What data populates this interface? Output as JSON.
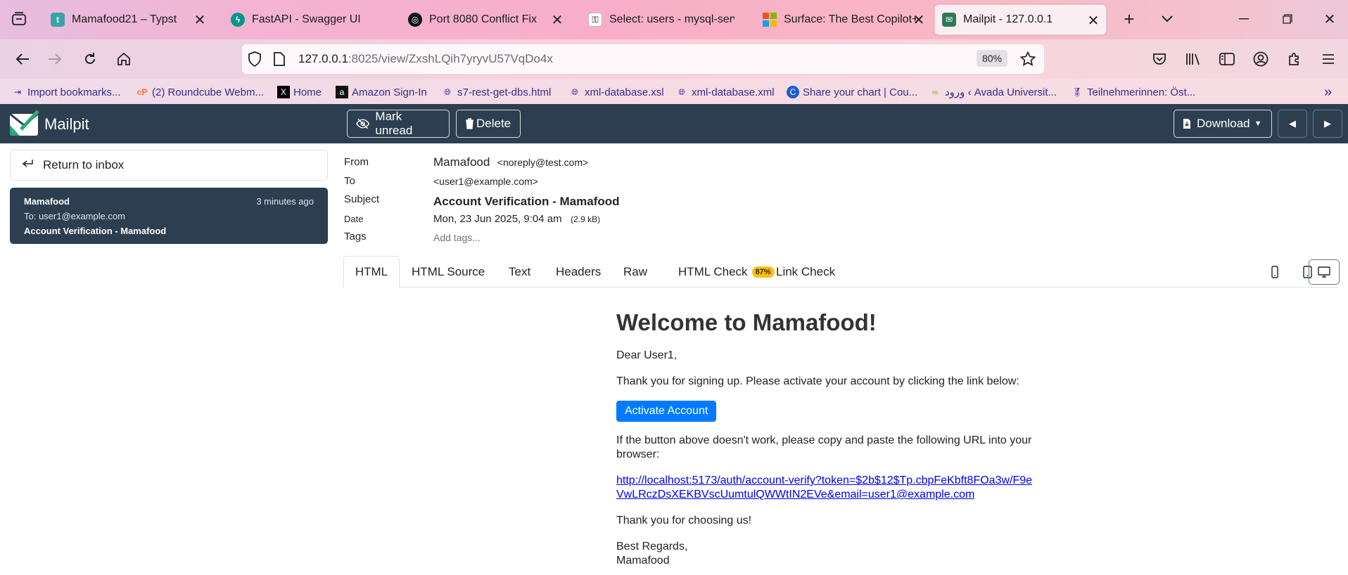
{
  "browser": {
    "tabs": [
      {
        "title": "Mamafood21 – Typst",
        "favicon_color": "#3aa3a7",
        "favicon_glyph": "t"
      },
      {
        "title": "FastAPI - Swagger UI",
        "favicon_color": "#049688",
        "favicon_glyph": "ϟ"
      },
      {
        "title": "Port 8080 Conflict Fix",
        "favicon_color": "#111111",
        "favicon_glyph": "◎"
      },
      {
        "title": "Select: users - mysql-servic",
        "favicon_color": "#b0b0b0",
        "favicon_glyph": "⚿"
      },
      {
        "title": "Surface: The Best Copilot+",
        "favicon_color": "#f25022",
        "favicon_glyph": ""
      },
      {
        "title": "Mailpit - 127.0.0.1",
        "favicon_color": "#2c7a5b",
        "favicon_glyph": "✉"
      }
    ],
    "url_host": "127.0.0.1",
    "url_rest": ":8025/view/ZxshLQih7yryvU57VqDo4x",
    "zoom": "80%",
    "bookmarks": [
      {
        "label": "Import bookmarks...",
        "icon": "import-icon"
      },
      {
        "label": "(2) Roundcube Webm...",
        "icon": "cpanel-icon"
      },
      {
        "label": "Home",
        "icon": "x-icon"
      },
      {
        "label": "Amazon Sign-In",
        "icon": "amazon-icon"
      },
      {
        "label": "s7-rest-get-dbs.html",
        "icon": "globe-icon"
      },
      {
        "label": "xml-database.xsl",
        "icon": "globe-icon"
      },
      {
        "label": "xml-database.xml",
        "icon": "globe-icon"
      },
      {
        "label": "Share your chart | Cou...",
        "icon": "c-icon"
      },
      {
        "label": "ورود ‹ Avada Universit...",
        "icon": "infinity-icon"
      },
      {
        "label": "Teilnehmerinnen: Öst...",
        "icon": "medal-icon"
      }
    ]
  },
  "mailpit": {
    "brand": "Mailpit",
    "toolbar": {
      "mark_unread": "Mark unread",
      "delete": "Delete",
      "download": "Download"
    },
    "sidebar": {
      "return_label": "Return to inbox",
      "message": {
        "from": "Mamafood",
        "time": "3 minutes ago",
        "to": "To: user1@example.com",
        "subject": "Account Verification - Mamafood"
      }
    },
    "headers": {
      "from_label": "From",
      "from_name": "Mamafood",
      "from_email": "<noreply@test.com>",
      "to_label": "To",
      "to_value": "<user1@example.com>",
      "subject_label": "Subject",
      "subject_value": "Account Verification - Mamafood",
      "date_label": "Date",
      "date_value": "Mon, 23 Jun 2025, 9:04 am",
      "size_value": "(2.9 kB)",
      "tags_label": "Tags",
      "tags_placeholder": "Add tags..."
    },
    "tabs": [
      {
        "label": "HTML"
      },
      {
        "label": "HTML Source"
      },
      {
        "label": "Text"
      },
      {
        "label": "Headers"
      },
      {
        "label": "Raw"
      },
      {
        "label": "HTML Check",
        "badge": "87%"
      },
      {
        "label": "Link Check"
      }
    ]
  },
  "email": {
    "heading": "Welcome to Mamafood!",
    "greeting": "Dear User1,",
    "intro": "Thank you for signing up. Please activate your account by clicking the link below:",
    "button": "Activate Account",
    "fallback": "If the button above doesn't work, please copy and paste the following URL into your browser:",
    "url": "http://localhost:5173/auth/account-verify?token=$2b$12$Tp.cbpFeKbft8FOa3w/F9eVwLRczDsXEKBVscUumtulQWWtIN2EVe&email=user1@example.com",
    "thanks": "Thank you for choosing us!",
    "signoff": "Best Regards,",
    "signature": "Mamafood"
  }
}
